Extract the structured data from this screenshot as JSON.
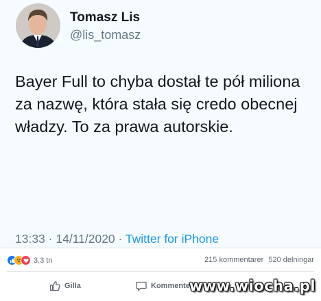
{
  "tweet": {
    "author_name": "Tomasz Lis",
    "author_handle": "@lis_tomasz",
    "text": "Bayer Full to chyba dostał te pół miliona za nazwę, która stała się credo obecnej władzy. To za prawa autorskie.",
    "time": "13:33",
    "separator_1": "·",
    "date": "14/11/2020",
    "separator_2": "·",
    "source": "Twitter for iPhone"
  },
  "facebook": {
    "reaction_icons": [
      "like-icon",
      "haha-icon",
      "love-icon"
    ],
    "reaction_count": "3,3 tn",
    "comments_count": "215 kommentarer",
    "shares_count": "520 delningar",
    "like_label": "Gilla",
    "comment_label": "Kommentera"
  },
  "watermark": "www.wiocha.pl",
  "colors": {
    "tweet_background": "#f5fbff",
    "link_blue": "#1b95e0",
    "fb_like_blue": "#1877f2",
    "fb_haha_yellow": "#f7b125",
    "fb_love_red": "#f33e58"
  }
}
